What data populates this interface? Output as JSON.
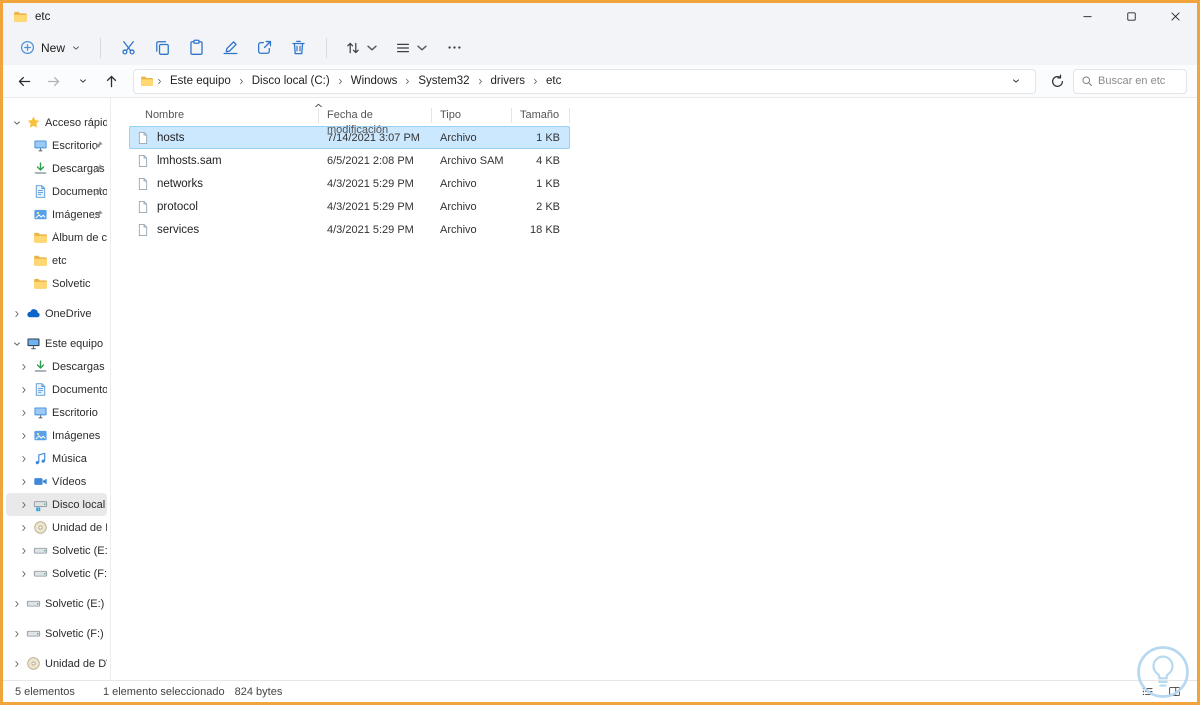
{
  "titlebar": {
    "title": "etc"
  },
  "toolbar": {
    "new_label": "New"
  },
  "navbar": {
    "breadcrumb": [
      "Este equipo",
      "Disco local (C:)",
      "Windows",
      "System32",
      "drivers",
      "etc"
    ],
    "search_placeholder": "Buscar en etc"
  },
  "sidebar": {
    "items": [
      "Acceso rápido",
      "Escritorio",
      "Descargas",
      "Documento",
      "Imágenes",
      "Álbum de cám",
      "etc",
      "Solvetic",
      "OneDrive",
      "Este equipo",
      "Descargas",
      "Documentos",
      "Escritorio",
      "Imágenes",
      "Música",
      "Vídeos",
      "Disco local (C:)",
      "Unidad de DVD",
      "Solvetic (E:)",
      "Solvetic (F:)",
      "Solvetic (E:)",
      "Solvetic (F:)",
      "Unidad de DVD ("
    ]
  },
  "file_list": {
    "columns": [
      "Nombre",
      "Fecha de modificación",
      "Tipo",
      "Tamaño"
    ],
    "rows": [
      {
        "name": "hosts",
        "date": "7/14/2021 3:07 PM",
        "type": "Archivo",
        "size": "1 KB"
      },
      {
        "name": "lmhosts.sam",
        "date": "6/5/2021 2:08 PM",
        "type": "Archivo SAM",
        "size": "4 KB"
      },
      {
        "name": "networks",
        "date": "4/3/2021 5:29 PM",
        "type": "Archivo",
        "size": "1 KB"
      },
      {
        "name": "protocol",
        "date": "4/3/2021 5:29 PM",
        "type": "Archivo",
        "size": "2 KB"
      },
      {
        "name": "services",
        "date": "4/3/2021 5:29 PM",
        "type": "Archivo",
        "size": "18 KB"
      }
    ]
  },
  "statusbar": {
    "count": "5 elementos",
    "selection": "1 elemento seleccionado",
    "size": "824 bytes"
  }
}
